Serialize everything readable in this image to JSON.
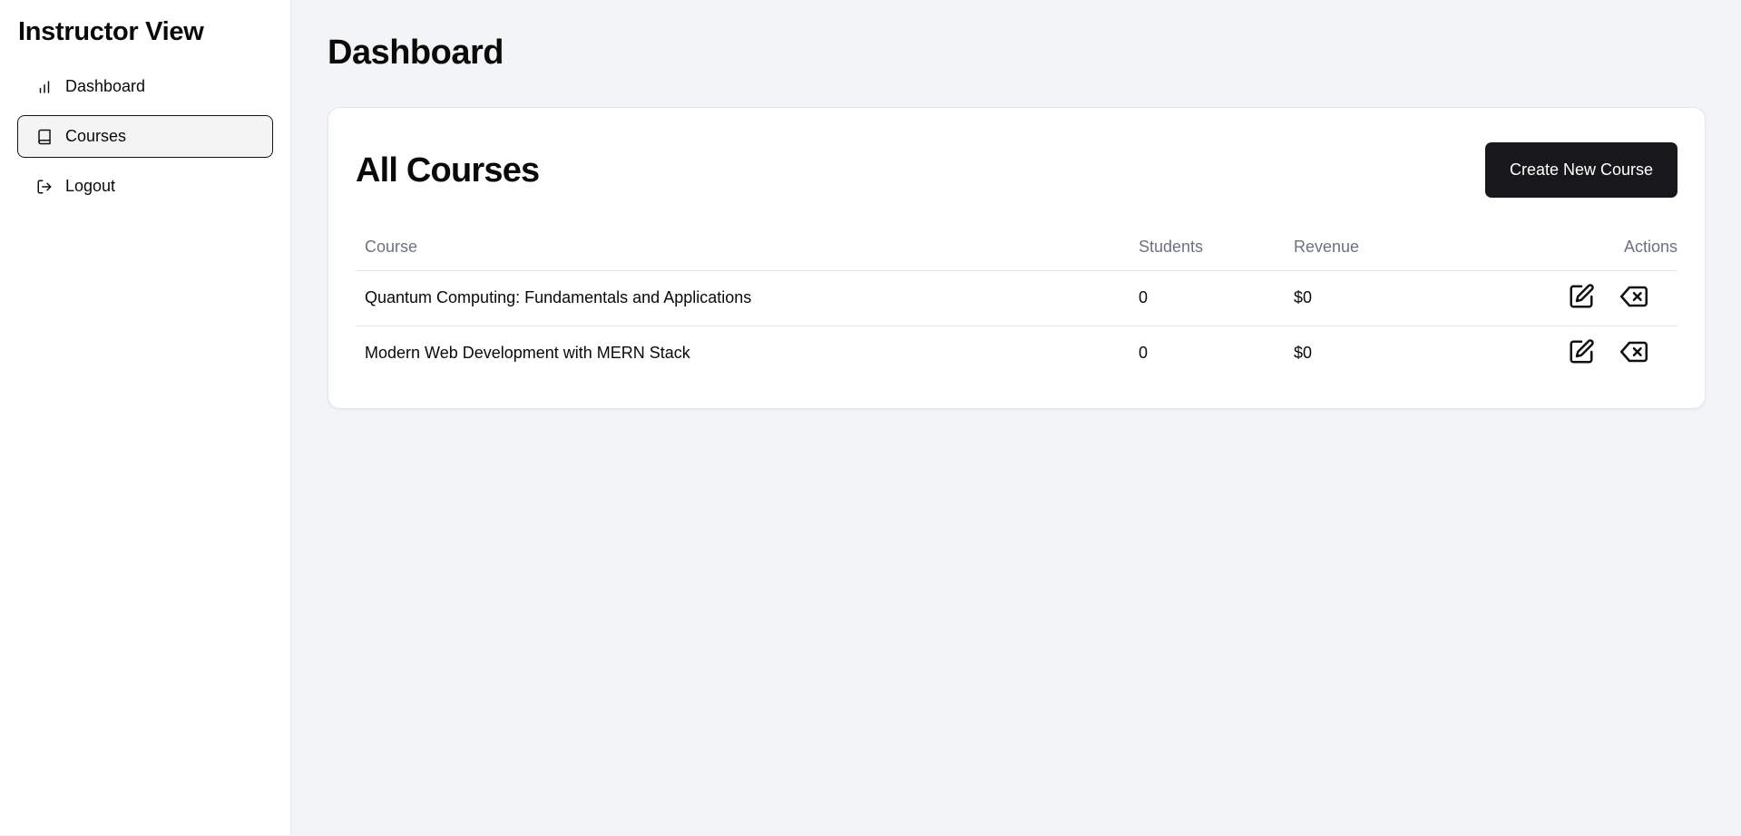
{
  "sidebar": {
    "title": "Instructor View",
    "items": [
      {
        "label": "Dashboard",
        "icon": "bar-chart-icon",
        "active": false
      },
      {
        "label": "Courses",
        "icon": "book-icon",
        "active": true
      },
      {
        "label": "Logout",
        "icon": "logout-icon",
        "active": false
      }
    ]
  },
  "main": {
    "title": "Dashboard",
    "card": {
      "title": "All Courses",
      "create_button": "Create New Course",
      "columns": [
        "Course",
        "Students",
        "Revenue",
        "Actions"
      ],
      "rows": [
        {
          "course": "Quantum Computing: Fundamentals and Applications",
          "students": "0",
          "revenue": "$0"
        },
        {
          "course": "Modern Web Development with MERN Stack",
          "students": "0",
          "revenue": "$0"
        }
      ]
    }
  },
  "colors": {
    "accent": "#18181b",
    "background": "#f3f4f6",
    "muted_text": "#6b7280"
  }
}
